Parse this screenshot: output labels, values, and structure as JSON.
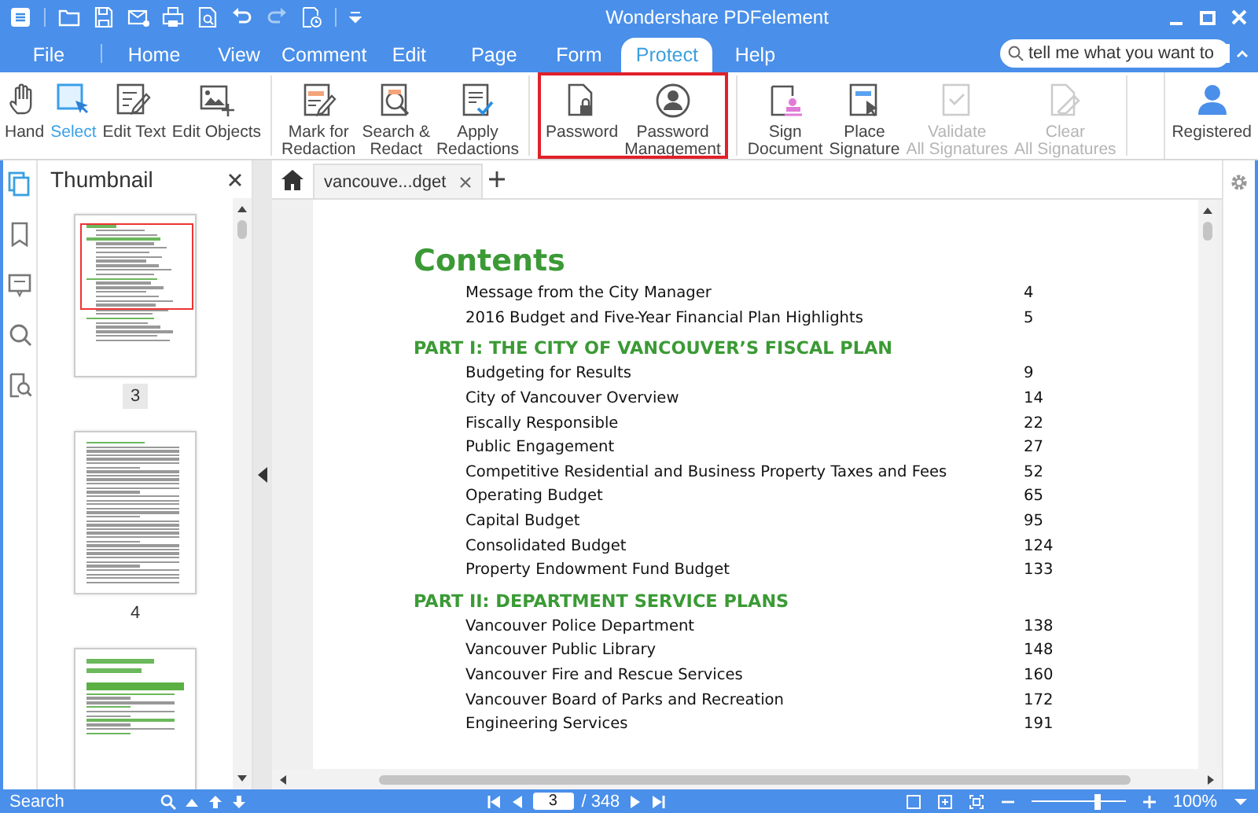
{
  "title_bar": {
    "title": "Wondershare PDFelement"
  },
  "menu_tabs": [
    {
      "label": "File",
      "selected": false
    },
    {
      "label": "Home",
      "selected": false
    },
    {
      "label": "View",
      "selected": false
    },
    {
      "label": "Comment",
      "selected": false
    },
    {
      "label": "Edit",
      "selected": false
    },
    {
      "label": "Page",
      "selected": false
    },
    {
      "label": "Form",
      "selected": false
    },
    {
      "label": "Protect",
      "selected": true
    },
    {
      "label": "Help",
      "selected": false
    }
  ],
  "search": {
    "placeholder": "tell me what you want to"
  },
  "ribbon": {
    "groups": [
      {
        "highlighted": false,
        "tools": [
          {
            "kind": "hand",
            "label": "Hand",
            "selected": false,
            "disabled": false
          },
          {
            "kind": "select",
            "label": "Select",
            "selected": true,
            "disabled": false
          },
          {
            "kind": "edit-text",
            "label": "Edit Text",
            "selected": false,
            "disabled": false
          },
          {
            "kind": "edit-objects",
            "label": "Edit Objects",
            "selected": false,
            "disabled": false
          }
        ]
      },
      {
        "highlighted": false,
        "tools": [
          {
            "kind": "mark",
            "label": "Mark for\nRedaction",
            "selected": false,
            "disabled": false
          },
          {
            "kind": "search-redact",
            "label": "Search &\nRedact",
            "selected": false,
            "disabled": false
          },
          {
            "kind": "apply",
            "label": "Apply\nRedactions",
            "selected": false,
            "disabled": false
          }
        ]
      },
      {
        "highlighted": true,
        "tools": [
          {
            "kind": "password",
            "label": "Password",
            "selected": false,
            "disabled": false
          },
          {
            "kind": "password-management",
            "label": "Password\nManagement",
            "selected": false,
            "disabled": false
          }
        ]
      },
      {
        "highlighted": false,
        "tools": [
          {
            "kind": "sign",
            "label": "Sign\nDocument",
            "selected": false,
            "disabled": false
          },
          {
            "kind": "place-signature",
            "label": "Place\nSignature",
            "selected": false,
            "disabled": false
          },
          {
            "kind": "validate",
            "label": "Validate\nAll Signatures",
            "selected": false,
            "disabled": true
          },
          {
            "kind": "clear",
            "label": "Clear\nAll Signatures",
            "selected": false,
            "disabled": true
          }
        ]
      }
    ],
    "account": {
      "label": "Registered"
    }
  },
  "sidebar": {
    "title": "Thumbnail",
    "thumbnails": [
      {
        "kind": "contents",
        "page_label": "3",
        "selected": true
      },
      {
        "kind": "letter",
        "page_label": "4",
        "selected": false
      },
      {
        "kind": "highlights",
        "selected": false
      }
    ]
  },
  "document_tabs": [
    {
      "label": "vancouve...dget",
      "selected": true
    }
  ],
  "document": {
    "heading": "Contents",
    "sections": [
      {
        "entries": [
          {
            "text": "Message from the City Manager",
            "page": "4"
          },
          {
            "text": "2016 Budget and Five-Year Financial Plan Highlights",
            "page": "5"
          }
        ]
      },
      {
        "title": "PART I: THE CITY OF VANCOUVER’S FISCAL PLAN",
        "entries": [
          {
            "text": "Budgeting for Results",
            "page": "9"
          },
          {
            "text": "City of Vancouver Overview",
            "page": "14"
          },
          {
            "text": "Fiscally Responsible",
            "page": "22"
          },
          {
            "text": "Public Engagement",
            "page": "27"
          },
          {
            "text": "Competitive Residential and Business Property Taxes and Fees",
            "page": "52"
          },
          {
            "text": "Operating Budget",
            "page": "65"
          },
          {
            "text": "Capital Budget",
            "page": "95"
          },
          {
            "text": "Consolidated Budget",
            "page": "124"
          },
          {
            "text": "Property Endowment Fund Budget",
            "page": "133"
          }
        ]
      },
      {
        "title": "PART II: DEPARTMENT SERVICE PLANS",
        "entries": [
          {
            "text": "Vancouver Police Department",
            "page": "138"
          },
          {
            "text": "Vancouver Public Library",
            "page": "148"
          },
          {
            "text": "Vancouver Fire and Rescue Services",
            "page": "160"
          },
          {
            "text": "Vancouver Board of Parks and Recreation",
            "page": "172"
          },
          {
            "text": "Engineering Services",
            "page": "191"
          }
        ]
      }
    ]
  },
  "status_bar": {
    "search_label": "Search",
    "page_input": "3",
    "page_total": "/ 348",
    "zoom": {
      "level": 0.7
    },
    "zoom_reading": "100%"
  }
}
